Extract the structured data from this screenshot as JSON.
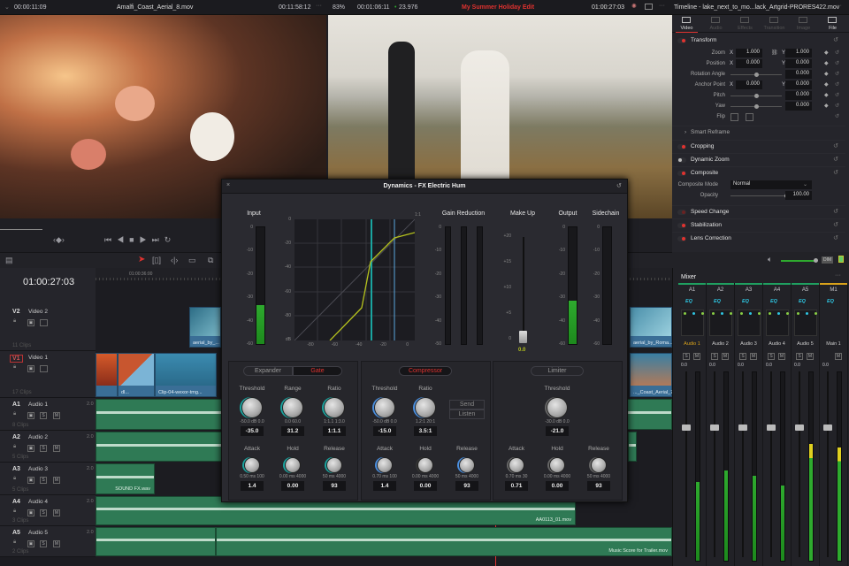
{
  "viewer_left": {
    "timecode_in": "00:00:11:09",
    "clip_name": "Amalfi_Coast_Aerial_8.mov",
    "duration": "00:11:58:12",
    "zoom": "83%",
    "timecode": "00:01:06:11",
    "fps": "23.976"
  },
  "viewer_right": {
    "timeline_name": "My Summer Holiday Edit",
    "timecode": "01:00:27:03"
  },
  "inspector": {
    "title": "Timeline - lake_next_to_mo...lack_Artgrid-PRORES422.mov",
    "tabs": [
      "Video",
      "Audio",
      "Effects",
      "Transition",
      "Image",
      "File"
    ],
    "transform": {
      "label": "Transform",
      "rows": [
        {
          "label": "Zoom",
          "x": "1.000",
          "y": "1.000"
        },
        {
          "label": "Position",
          "x": "0.000",
          "y": "0.000"
        },
        {
          "label": "Rotation Angle",
          "value": "0.000"
        },
        {
          "label": "Anchor Point",
          "x": "0.000",
          "y": "0.000"
        },
        {
          "label": "Pitch",
          "value": "0.000"
        },
        {
          "label": "Yaw",
          "value": "0.000"
        },
        {
          "label": "Flip"
        }
      ],
      "x_label": "X",
      "y_label": "Y"
    },
    "smart_reframe": "Smart Reframe",
    "cropping": "Cropping",
    "dynamic_zoom": "Dynamic Zoom",
    "composite": {
      "label": "Composite",
      "mode_label": "Composite Mode",
      "mode": "Normal",
      "opacity_label": "Opacity",
      "opacity": "100.00"
    },
    "speed_change": "Speed Change",
    "stabilization": "Stabilization",
    "lens_correction": "Lens Correction"
  },
  "timeline": {
    "timecode": "01:00:27:03",
    "ruler_label": "01:00:36:00",
    "tracks": [
      {
        "id": "V2",
        "name": "Video 2",
        "clips": "11 Clips"
      },
      {
        "id": "V1",
        "name": "Video 1",
        "clips": "17 Clips"
      },
      {
        "id": "A1",
        "name": "Audio 1",
        "clips": "8 Clips",
        "ch": "2.0"
      },
      {
        "id": "A2",
        "name": "Audio 2",
        "clips": "5 Clips",
        "ch": "2.0"
      },
      {
        "id": "A3",
        "name": "Audio 3",
        "clips": "5 Clips",
        "ch": "2.0"
      },
      {
        "id": "A4",
        "name": "Audio 4",
        "clips": "3 Clips",
        "ch": "2.0"
      },
      {
        "id": "A5",
        "name": "Audio 5",
        "clips": "2 Clips",
        "ch": "2.0"
      }
    ],
    "clip_names": {
      "v2_a": "aerial_by_...",
      "v2_b": "aerial_by_Roma...",
      "v1_a": "dl...",
      "v1_b": "Clip-04-wexor-tmg...",
      "v1_c": "..._Coast_Aerial_7.mov",
      "a3": "SOUND FX.wav",
      "a4": "AA0113_01.mov",
      "a5": "Music Score for Trailer.mov"
    },
    "track_buttons": {
      "solo": "S",
      "mute": "M"
    }
  },
  "dynamics": {
    "title": "Dynamics - FX Electric Hum",
    "labels": {
      "input": "Input",
      "gain_reduction": "Gain Reduction",
      "make_up": "Make Up",
      "output": "Output",
      "sidechain": "Sidechain",
      "ratio_tag": "1:1"
    },
    "meter_ticks": [
      "0",
      "-10",
      "-20",
      "-30",
      "-40",
      "-60"
    ],
    "gr_ticks": [
      "0",
      "-10",
      "-20",
      "-30",
      "-40",
      "-50"
    ],
    "makeup_ticks": [
      "+20",
      "+15",
      "+10",
      "+5",
      "0"
    ],
    "graph_y": [
      "0",
      "-20",
      "-40",
      "-60",
      "-80",
      "dB"
    ],
    "graph_x": [
      "-80",
      "-60",
      "-40",
      "-20",
      "0"
    ],
    "makeup_value": "0.0",
    "input_level": 0.33,
    "output_level": 0.37,
    "gate": {
      "tab_expander": "Expander",
      "tab_gate": "Gate",
      "knobs": [
        {
          "label": "Threshold",
          "min": "-50.0 dB",
          "max": "0.0",
          "value": "-35.0"
        },
        {
          "label": "Range",
          "min": "0.0",
          "max": "60.0",
          "value": "31.2"
        },
        {
          "label": "Ratio",
          "min": "1:1.1",
          "max": "1:3.0",
          "value": "1:1.1"
        },
        {
          "label": "Attack",
          "min": "0.50",
          "unit": "ms",
          "max": "100",
          "value": "1.4"
        },
        {
          "label": "Hold",
          "min": "0.00",
          "unit": "ms",
          "max": "4000",
          "value": "0.00"
        },
        {
          "label": "Release",
          "min": "50",
          "unit": "ms",
          "max": "4000",
          "value": "93"
        }
      ]
    },
    "compressor": {
      "tab": "Compressor",
      "send": "Send",
      "listen": "Listen",
      "knobs": [
        {
          "label": "Threshold",
          "min": "-50.0 dB",
          "max": "0.0",
          "value": "-15.0"
        },
        {
          "label": "Ratio",
          "min": "1.2:1",
          "max": "20:1",
          "value": "3.5:1"
        },
        {
          "label": "Attack",
          "min": "0.70",
          "unit": "ms",
          "max": "100",
          "value": "1.4"
        },
        {
          "label": "Hold",
          "min": "0.00",
          "unit": "ms",
          "max": "4000",
          "value": "0.00"
        },
        {
          "label": "Release",
          "min": "50",
          "unit": "ms",
          "max": "4000",
          "value": "93"
        }
      ]
    },
    "limiter": {
      "tab": "Limiter",
      "knobs": [
        {
          "label": "Threshold",
          "min": "-30.0 dB",
          "max": "0.0",
          "value": "-21.0"
        },
        {
          "label": "Attack",
          "min": "0.70",
          "unit": "ms",
          "max": "30",
          "value": "0.71"
        },
        {
          "label": "Hold",
          "min": "0.00",
          "unit": "ms",
          "max": "4000",
          "value": "0.00"
        },
        {
          "label": "Release",
          "min": "50",
          "unit": "ms",
          "max": "4000",
          "value": "93"
        }
      ]
    }
  },
  "mixer": {
    "title": "Mixer",
    "dim": "DIM",
    "eq": "EQ",
    "channels": [
      {
        "id": "A1",
        "name": "Audio 1",
        "value": "0.0",
        "level": 0.42
      },
      {
        "id": "A2",
        "name": "Audio 2",
        "value": "0.0",
        "level": 0.48
      },
      {
        "id": "A3",
        "name": "Audio 3",
        "value": "0.0",
        "level": 0.45
      },
      {
        "id": "A4",
        "name": "Audio 4",
        "value": "0.0",
        "level": 0.4
      },
      {
        "id": "A5",
        "name": "Audio 5",
        "value": "0.0",
        "level": 0.62
      },
      {
        "id": "M1",
        "name": "Main 1",
        "value": "0.0",
        "level": 0.6
      }
    ]
  },
  "colors": {
    "accent": "#e0322f",
    "meter": "#2eaa2e",
    "audio_clip": "#2f7a55",
    "video_clip": "#3a6e96",
    "eq": "#2ec4e0"
  }
}
